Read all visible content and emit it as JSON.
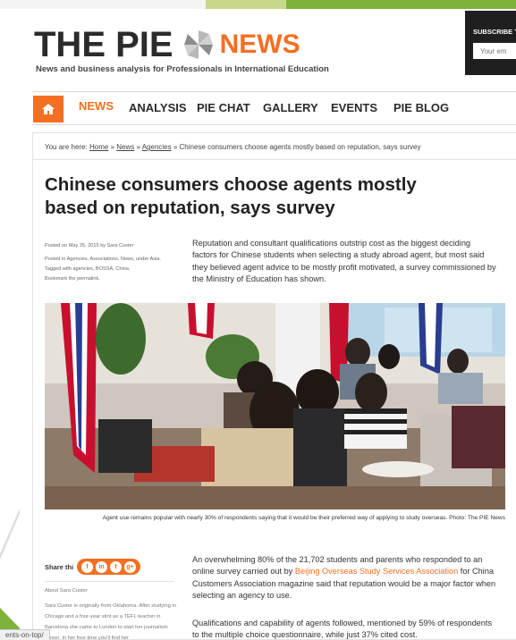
{
  "header": {
    "logo_the": "THE PIE",
    "logo_news": "NEWS",
    "tagline": "News and business analysis for Professionals in International Education",
    "subscribe_label": "SUBSCRIBE T",
    "subscribe_placeholder": "Your em",
    "subscribe_icon": "mail-icon"
  },
  "nav": {
    "home_icon": "home-icon",
    "items": [
      "NEWS",
      "ANALYSIS",
      "PIE CHAT",
      "GALLERY",
      "EVENTS",
      "PIE BLOG"
    ]
  },
  "breadcrumb": {
    "prefix": "You are here:",
    "home": "Home",
    "news": "News",
    "agencies": "Agencies",
    "current": "Chinese consumers choose agents mostly based on reputation, says survey"
  },
  "article": {
    "title": "Chinese consumers choose agents mostly based on reputation, says survey",
    "meta": {
      "posted_on": "Posted on May 25, 2015 by Sara Custer",
      "posted_in": "Posted in Agencies, Associations, News, under Asia.",
      "tagged": "Tagged with agencies, BOSSA, China.",
      "bookmark": "Bookmark the permalink."
    },
    "lede": "Reputation and consultant qualifications outstrip cost as the biggest deciding factors for Chinese students when selecting a study abroad agent, but most said they believed agent advice to be mostly profit motivated, a survey commissioned by the Ministry of Education has shown.",
    "caption": "Agent use remains popular with nearly 30% of respondents saying that it would be their preferred way of applying to study overseas. Photo: The PIE News",
    "share_label": "Share thi",
    "share_icons": [
      "f",
      "in",
      "t",
      "g+"
    ],
    "about_title": "About Sara Custer",
    "about_body": "Sara Custer is originally from Oklahoma. After studying in Chicago and a four-year stint as a TEFL teacher in Barcelona she came to London to start her journalism career. In her free time you'll find her",
    "p1_before": "An overwhelming 80% of the 21,702 students and parents who responded to an online survey carried out by ",
    "p1_link": "Beijing Overseas Study Services Association",
    "p1_after": " for China Customers Association magazine said that reputation would be a major factor when selecting an agency to use.",
    "p2": "Qualifications and capability of agents followed, mentioned by 59% of respondents to the multiple choice questionnaire, while just 37% cited cost."
  },
  "status_bar": {
    "url": "ents-on-top/"
  },
  "colors": {
    "accent": "#f36f21",
    "dark": "#2b2b2b",
    "green": "#7fb23a"
  }
}
